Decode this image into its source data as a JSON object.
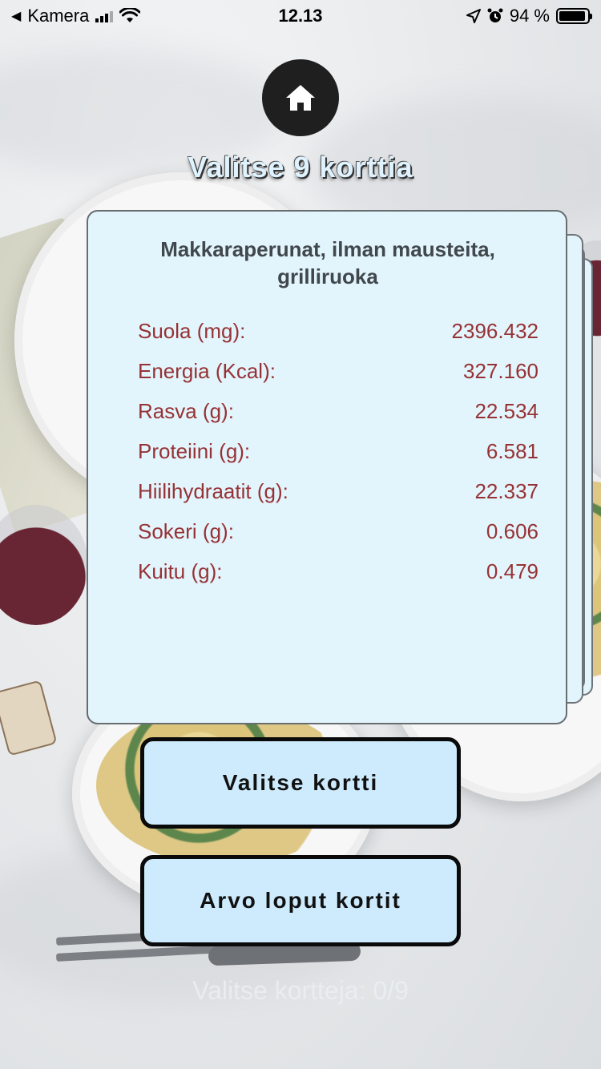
{
  "status_bar": {
    "back_label": "Kamera",
    "time": "12.13",
    "battery_percent_label": "94 %",
    "battery_level": 0.94
  },
  "header": {
    "home_icon": "home-icon",
    "title": "Valitse 9 korttia"
  },
  "card": {
    "title": "Makkaraperunat, ilman mausteita, grilliruoka",
    "nutrients": [
      {
        "label": "Suola (mg):",
        "value": "2396.432"
      },
      {
        "label": "Energia (Kcal):",
        "value": "327.160"
      },
      {
        "label": "Rasva (g):",
        "value": "22.534"
      },
      {
        "label": "Proteiini (g):",
        "value": "6.581"
      },
      {
        "label": "Hiilihydraatit (g):",
        "value": "22.337"
      },
      {
        "label": "Sokeri (g):",
        "value": "0.606"
      },
      {
        "label": "Kuitu (g):",
        "value": "0.479"
      }
    ]
  },
  "buttons": {
    "select_card": "Valitse kortti",
    "randomize_rest": "Arvo loput kortit"
  },
  "footer": {
    "counter": "Valitse kortteja: 0/9"
  },
  "colors": {
    "card_bg": "#e3f5fc",
    "button_bg": "#cdebfd",
    "value_text": "#963235",
    "title_text": "#40474d"
  }
}
